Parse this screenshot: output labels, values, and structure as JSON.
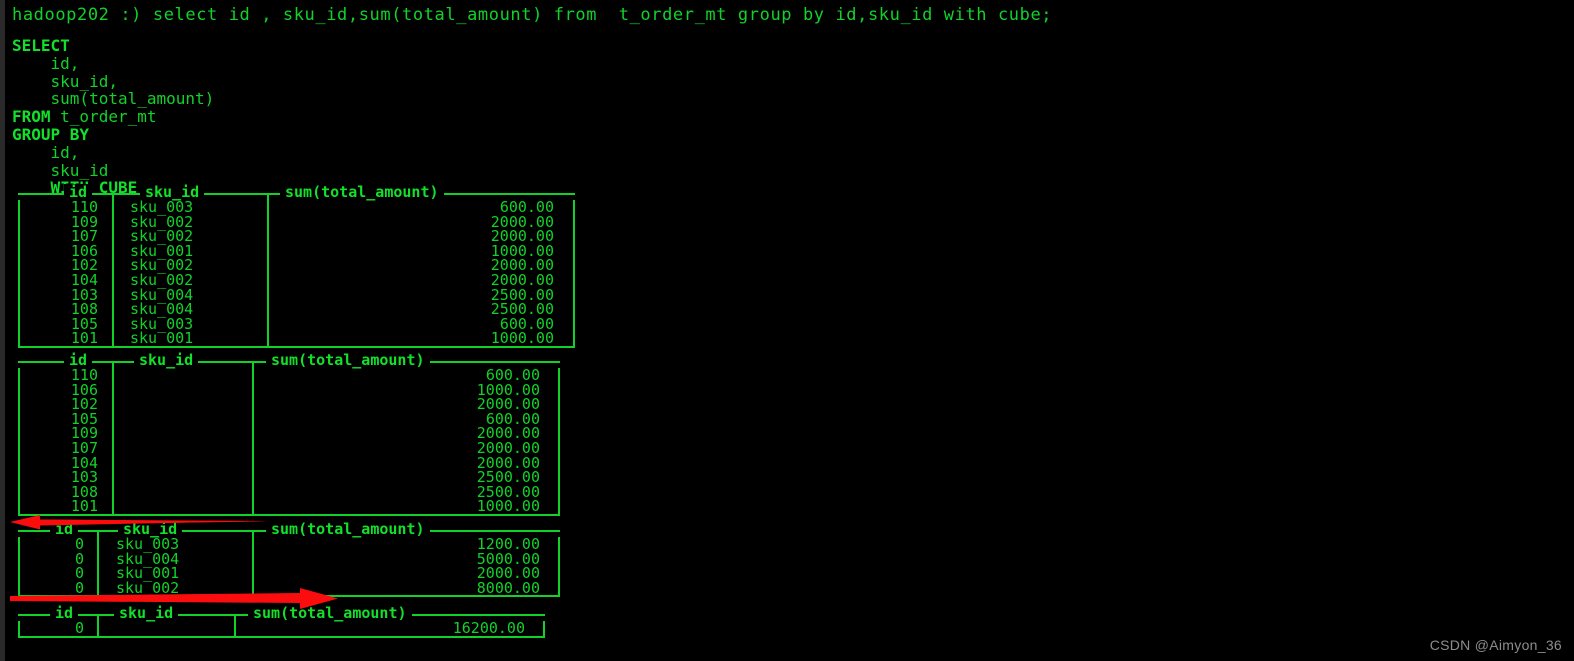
{
  "terminal": {
    "prompt": "hadoop202 :) select id , sku_id,sum(total_amount) from  t_order_mt group by id,sku_id with cube;",
    "sql_echo": [
      {
        "keyword": "SELECT",
        "rest": ""
      },
      {
        "keyword": "",
        "rest": "    id,"
      },
      {
        "keyword": "",
        "rest": "    sku_id,"
      },
      {
        "keyword": "",
        "rest": "    sum(total_amount)"
      },
      {
        "keyword": "FROM",
        "rest": " t_order_mt"
      },
      {
        "keyword": "GROUP BY",
        "rest": ""
      },
      {
        "keyword": "",
        "rest": "    id,"
      },
      {
        "keyword": "",
        "rest": "    sku_id"
      },
      {
        "keyword": "    WITH CUBE",
        "rest": ""
      }
    ],
    "colors": {
      "background": "#000000",
      "text": "#12d22a",
      "annotation": "#fb0d0d",
      "watermark": "#8d8d8d"
    }
  },
  "tables": [
    {
      "name": "result-table-1",
      "columns": [
        "id",
        "sku_id",
        "sum(total_amount)"
      ],
      "rows": [
        {
          "id": "110",
          "sku_id": "sku_003",
          "sum": "600.00"
        },
        {
          "id": "109",
          "sku_id": "sku_002",
          "sum": "2000.00"
        },
        {
          "id": "107",
          "sku_id": "sku_002",
          "sum": "2000.00"
        },
        {
          "id": "106",
          "sku_id": "sku_001",
          "sum": "1000.00"
        },
        {
          "id": "102",
          "sku_id": "sku_002",
          "sum": "2000.00"
        },
        {
          "id": "104",
          "sku_id": "sku_002",
          "sum": "2000.00"
        },
        {
          "id": "103",
          "sku_id": "sku_004",
          "sum": "2500.00"
        },
        {
          "id": "108",
          "sku_id": "sku_004",
          "sum": "2500.00"
        },
        {
          "id": "105",
          "sku_id": "sku_003",
          "sum": "600.00"
        },
        {
          "id": "101",
          "sku_id": "sku_001",
          "sum": "1000.00"
        }
      ]
    },
    {
      "name": "result-table-2",
      "columns": [
        "id",
        "sku_id",
        "sum(total_amount)"
      ],
      "rows": [
        {
          "id": "110",
          "sku_id": "",
          "sum": "600.00"
        },
        {
          "id": "106",
          "sku_id": "",
          "sum": "1000.00"
        },
        {
          "id": "102",
          "sku_id": "",
          "sum": "2000.00"
        },
        {
          "id": "105",
          "sku_id": "",
          "sum": "600.00"
        },
        {
          "id": "109",
          "sku_id": "",
          "sum": "2000.00"
        },
        {
          "id": "107",
          "sku_id": "",
          "sum": "2000.00"
        },
        {
          "id": "104",
          "sku_id": "",
          "sum": "2000.00"
        },
        {
          "id": "103",
          "sku_id": "",
          "sum": "2500.00"
        },
        {
          "id": "108",
          "sku_id": "",
          "sum": "2500.00"
        },
        {
          "id": "101",
          "sku_id": "",
          "sum": "1000.00"
        }
      ]
    },
    {
      "name": "result-table-3",
      "columns": [
        "id",
        "sku_id",
        "sum(total_amount)"
      ],
      "rows": [
        {
          "id": "0",
          "sku_id": "sku_003",
          "sum": "1200.00"
        },
        {
          "id": "0",
          "sku_id": "sku_004",
          "sum": "5000.00"
        },
        {
          "id": "0",
          "sku_id": "sku_001",
          "sum": "2000.00"
        },
        {
          "id": "0",
          "sku_id": "sku_002",
          "sum": "8000.00"
        }
      ]
    },
    {
      "name": "result-table-4",
      "columns": [
        "id",
        "sku_id",
        "sum(total_amount)"
      ],
      "rows": [
        {
          "id": "0",
          "sku_id": "",
          "sum": "16200.00"
        }
      ]
    }
  ],
  "annotations": [
    {
      "name": "arrow-left-table3",
      "direction": "left"
    },
    {
      "name": "arrow-right-table4",
      "direction": "right"
    }
  ],
  "watermark": "CSDN @Aimyon_36"
}
